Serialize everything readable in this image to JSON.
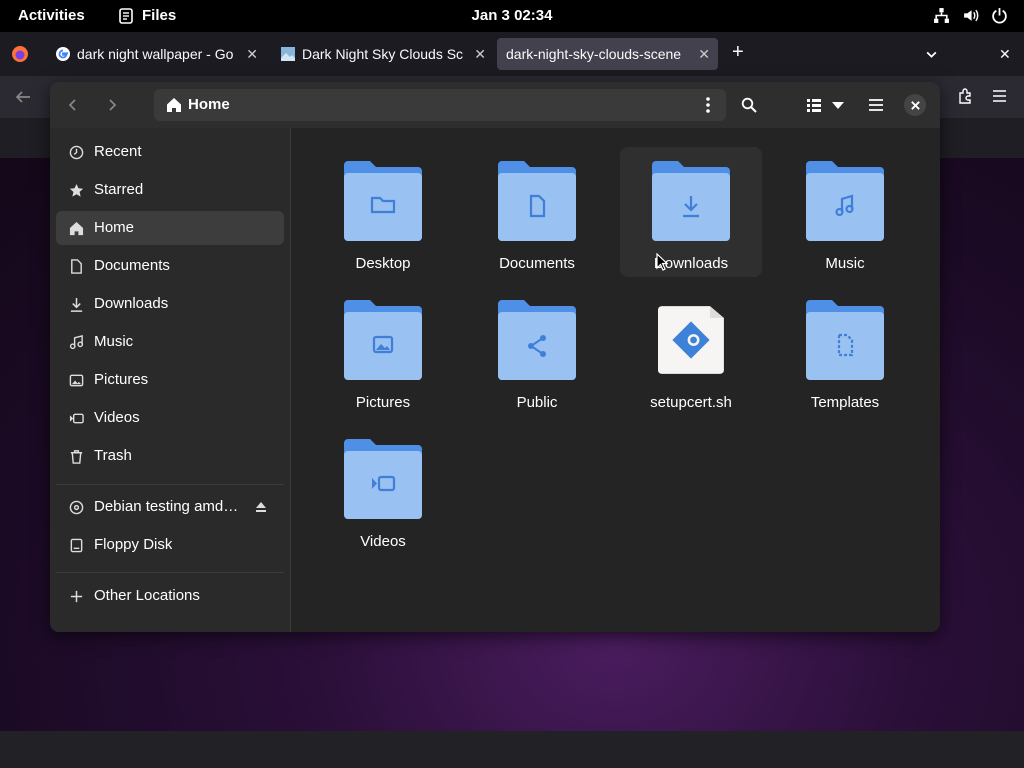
{
  "topbar": {
    "activities": "Activities",
    "app_name": "Files",
    "datetime": "Jan 3  02:34"
  },
  "browser": {
    "tabs": [
      {
        "title": "dark night wallpaper - Go"
      },
      {
        "title": "Dark Night Sky Clouds Sc"
      },
      {
        "title": "dark-night-sky-clouds-scene"
      }
    ],
    "new_tab": "+",
    "list_tabs": "⌄",
    "close": "✕"
  },
  "window": {
    "path_label": "Home",
    "sidebar": [
      {
        "label": "Recent",
        "icon": "clock-icon"
      },
      {
        "label": "Starred",
        "icon": "star-icon"
      },
      {
        "label": "Home",
        "icon": "home-icon",
        "active": true
      },
      {
        "label": "Documents",
        "icon": "document-icon"
      },
      {
        "label": "Downloads",
        "icon": "download-icon"
      },
      {
        "label": "Music",
        "icon": "music-icon"
      },
      {
        "label": "Pictures",
        "icon": "picture-icon"
      },
      {
        "label": "Videos",
        "icon": "video-icon"
      },
      {
        "label": "Trash",
        "icon": "trash-icon"
      }
    ],
    "devices": [
      {
        "label": "Debian testing amd…",
        "icon": "disc-icon"
      },
      {
        "label": "Floppy Disk",
        "icon": "drive-icon"
      }
    ],
    "other_locations": "Other Locations",
    "files": [
      {
        "name": "Desktop",
        "emblem": "folder"
      },
      {
        "name": "Documents",
        "emblem": "document"
      },
      {
        "name": "Downloads",
        "emblem": "download"
      },
      {
        "name": "Music",
        "emblem": "music"
      },
      {
        "name": "Pictures",
        "emblem": "picture"
      },
      {
        "name": "Public",
        "emblem": "share"
      },
      {
        "name": "setupcert.sh",
        "emblem": "script"
      },
      {
        "name": "Templates",
        "emblem": "template"
      },
      {
        "name": "Videos",
        "emblem": "video"
      }
    ]
  },
  "colors": {
    "folder_back": "#4f8fe6",
    "folder_front": "#99c1f1",
    "emblem": "#3f7fd8",
    "accent": "#3584e4"
  }
}
